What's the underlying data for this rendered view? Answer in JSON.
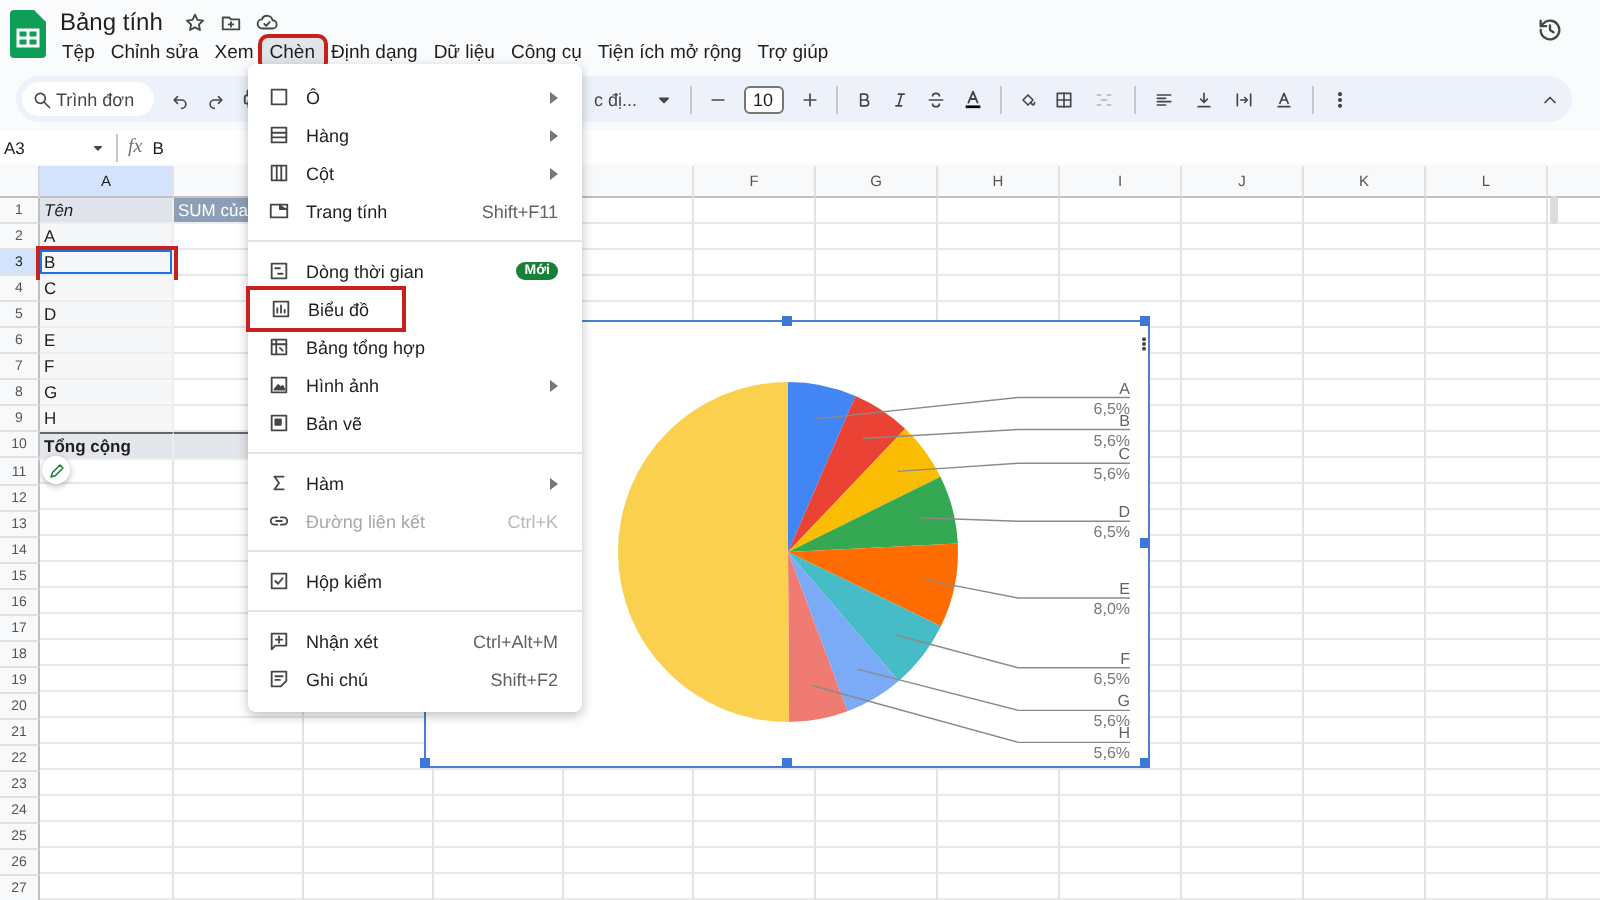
{
  "document": {
    "title": "Bảng tính"
  },
  "menu_bar": [
    {
      "label": "Tệp",
      "selected": false,
      "highlighted": false
    },
    {
      "label": "Chỉnh sửa",
      "selected": false,
      "highlighted": false
    },
    {
      "label": "Xem",
      "selected": false,
      "highlighted": false
    },
    {
      "label": "Chèn",
      "selected": true,
      "highlighted": true
    },
    {
      "label": "Định dạng",
      "selected": false,
      "highlighted": false
    },
    {
      "label": "Dữ liệu",
      "selected": false,
      "highlighted": false
    },
    {
      "label": "Công cụ",
      "selected": false,
      "highlighted": false
    },
    {
      "label": "Tiện ích mở rộng",
      "selected": false,
      "highlighted": false
    },
    {
      "label": "Trợ giúp",
      "selected": false,
      "highlighted": false
    }
  ],
  "toolbar": {
    "search": {
      "placeholder": "Trình đơn"
    },
    "font": "c đị...",
    "font_size": "10"
  },
  "formula_bar": {
    "cell_ref": "A3",
    "function_label": "fx",
    "formula": "B"
  },
  "sheet": {
    "columns": [
      {
        "label": "A",
        "selected": true
      },
      {
        "label": "F",
        "selected": false
      },
      {
        "label": "G",
        "selected": false
      },
      {
        "label": "H",
        "selected": false
      },
      {
        "label": "I",
        "selected": false
      },
      {
        "label": "J",
        "selected": false
      },
      {
        "label": "K",
        "selected": false
      },
      {
        "label": "L",
        "selected": false
      }
    ],
    "rows": [
      {
        "number": "1",
        "selected": false,
        "cells": [
          {
            "text": "Tên",
            "kind": "header",
            "selected": false,
            "highlighted": false
          },
          {
            "text": "SUM của",
            "kind": "sum-header",
            "selected": false,
            "highlighted": false
          }
        ]
      },
      {
        "number": "2",
        "selected": false,
        "cells": [
          {
            "text": "A",
            "kind": "item",
            "selected": false,
            "highlighted": false
          }
        ]
      },
      {
        "number": "3",
        "selected": true,
        "cells": [
          {
            "text": "B",
            "kind": "item",
            "selected": true,
            "highlighted": true
          }
        ]
      },
      {
        "number": "4",
        "selected": false,
        "cells": [
          {
            "text": "C",
            "kind": "item",
            "selected": false,
            "highlighted": false
          }
        ]
      },
      {
        "number": "5",
        "selected": false,
        "cells": [
          {
            "text": "D",
            "kind": "item",
            "selected": false,
            "highlighted": false
          }
        ]
      },
      {
        "number": "6",
        "selected": false,
        "cells": [
          {
            "text": "E",
            "kind": "item",
            "selected": false,
            "highlighted": false
          }
        ]
      },
      {
        "number": "7",
        "selected": false,
        "cells": [
          {
            "text": "F",
            "kind": "item",
            "selected": false,
            "highlighted": false
          }
        ]
      },
      {
        "number": "8",
        "selected": false,
        "cells": [
          {
            "text": "G",
            "kind": "item",
            "selected": false,
            "highlighted": false
          }
        ]
      },
      {
        "number": "9",
        "selected": false,
        "cells": [
          {
            "text": "H",
            "kind": "item",
            "selected": false,
            "highlighted": false
          }
        ]
      },
      {
        "number": "10",
        "selected": false,
        "cells": [
          {
            "text": "Tổng cộng",
            "kind": "total",
            "selected": false,
            "highlighted": false
          }
        ]
      },
      {
        "number": "11",
        "selected": false,
        "cells": []
      },
      {
        "number": "12",
        "selected": false,
        "cells": []
      },
      {
        "number": "13",
        "selected": false,
        "cells": []
      },
      {
        "number": "14",
        "selected": false,
        "cells": []
      },
      {
        "number": "15",
        "selected": false,
        "cells": []
      },
      {
        "number": "16",
        "selected": false,
        "cells": []
      },
      {
        "number": "17",
        "selected": false,
        "cells": []
      },
      {
        "number": "18",
        "selected": false,
        "cells": []
      },
      {
        "number": "19",
        "selected": false,
        "cells": []
      },
      {
        "number": "20",
        "selected": false,
        "cells": []
      },
      {
        "number": "21",
        "selected": false,
        "cells": []
      },
      {
        "number": "22",
        "selected": false,
        "cells": []
      },
      {
        "number": "23",
        "selected": false,
        "cells": []
      },
      {
        "number": "24",
        "selected": false,
        "cells": []
      },
      {
        "number": "25",
        "selected": false,
        "cells": []
      },
      {
        "number": "26",
        "selected": false,
        "cells": []
      },
      {
        "number": "27",
        "selected": false,
        "cells": []
      }
    ]
  },
  "chart": {
    "chart_data": {
      "type": "pie",
      "categories": [
        "A",
        "B",
        "C",
        "D",
        "E",
        "F",
        "G",
        "H",
        null
      ],
      "values": [
        6.5,
        5.6,
        5.6,
        6.5,
        8.0,
        6.5,
        5.6,
        5.6,
        50.1
      ],
      "colors": [
        "#4285f4",
        "#ea4335",
        "#fbbc04",
        "#34a853",
        "#ff6d01",
        "#46bdc6",
        "#7baaf7",
        "#f07b72",
        "#fcd04f"
      ],
      "data_labels": true,
      "value_labels": [
        "6,5%",
        "5,6%",
        "5,6%",
        "6,5%",
        "8,0%",
        "6,5%",
        "5,6%",
        "5,6%",
        null
      ]
    }
  },
  "insert_menu": {
    "sections": [
      [
        {
          "label": "Ô",
          "submenu": true,
          "disabled": false,
          "highlighted": false
        },
        {
          "label": "Hàng",
          "submenu": true,
          "disabled": false,
          "highlighted": false
        },
        {
          "label": "Cột",
          "submenu": true,
          "disabled": false,
          "highlighted": false
        },
        {
          "label": "Trang tính",
          "shortcut": "Shift+F11",
          "submenu": false,
          "disabled": false,
          "highlighted": false
        }
      ],
      [
        {
          "label": "Dòng thời gian",
          "badge": "Mới",
          "submenu": false,
          "disabled": false,
          "highlighted": false
        },
        {
          "label": "Biểu đồ",
          "submenu": false,
          "disabled": false,
          "highlighted": true
        },
        {
          "label": "Bảng tổng hợp",
          "submenu": false,
          "disabled": false,
          "highlighted": false
        },
        {
          "label": "Hình ảnh",
          "submenu": true,
          "disabled": false,
          "highlighted": false
        },
        {
          "label": "Bản vẽ",
          "submenu": false,
          "disabled": false,
          "highlighted": false
        }
      ],
      [
        {
          "label": "Hàm",
          "submenu": true,
          "disabled": false,
          "highlighted": false
        },
        {
          "label": "Đường liên kết",
          "shortcut": "Ctrl+K",
          "submenu": false,
          "disabled": true,
          "highlighted": false
        }
      ],
      [
        {
          "label": "Hộp kiểm",
          "submenu": false,
          "disabled": false,
          "highlighted": false
        }
      ],
      [
        {
          "label": "Nhận xét",
          "shortcut": "Ctrl+Alt+M",
          "submenu": false,
          "disabled": false,
          "highlighted": false
        },
        {
          "label": "Ghi chú",
          "shortcut": "Shift+F2",
          "submenu": false,
          "disabled": false,
          "highlighted": false
        }
      ]
    ]
  }
}
